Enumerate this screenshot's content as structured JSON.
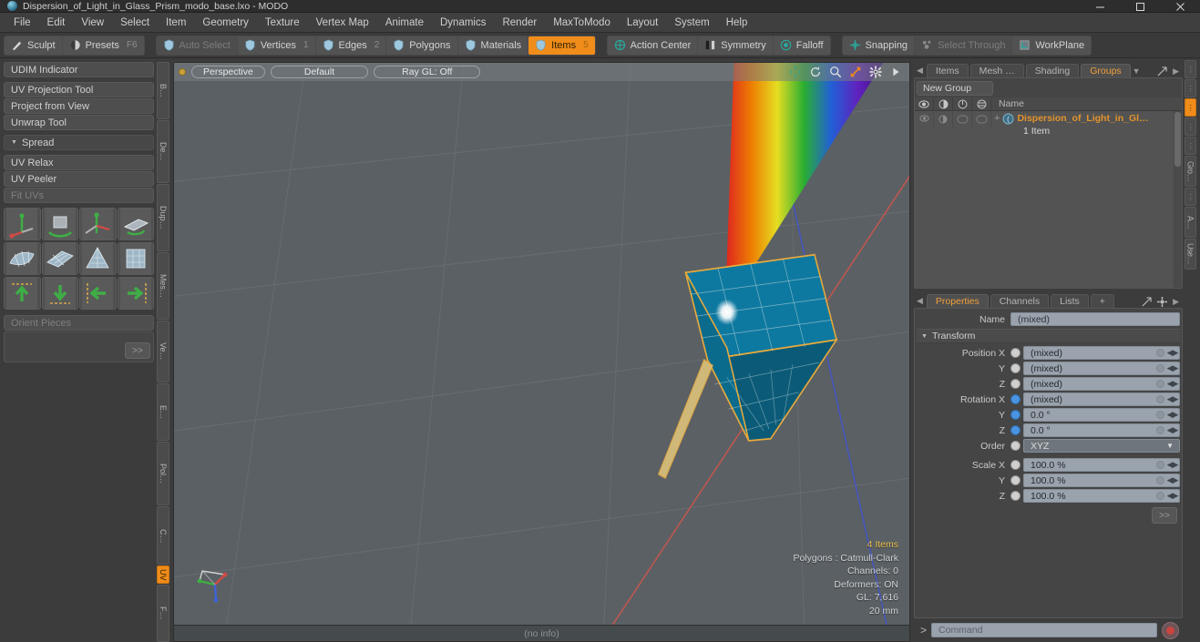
{
  "window": {
    "title": "Dispersion_of_Light_in_Glass_Prism_modo_base.lxo - MODO",
    "app_icon": "modo-sphere-icon",
    "minimize": "–",
    "maximize": "☐",
    "close": "✕"
  },
  "menubar": {
    "items": [
      {
        "label": "File"
      },
      {
        "label": "Edit"
      },
      {
        "label": "View"
      },
      {
        "label": "Select"
      },
      {
        "label": "Item"
      },
      {
        "label": "Geometry"
      },
      {
        "label": "Texture"
      },
      {
        "label": "Vertex Map"
      },
      {
        "label": "Animate"
      },
      {
        "label": "Dynamics"
      },
      {
        "label": "Render"
      },
      {
        "label": "MaxToModo"
      },
      {
        "label": "Layout"
      },
      {
        "label": "System"
      },
      {
        "label": "Help"
      }
    ]
  },
  "toolbar": {
    "group1": [
      {
        "label": "Sculpt",
        "icon": "brush-icon",
        "state": "normal",
        "num": ""
      },
      {
        "label": "Presets",
        "icon": "sphere-icon",
        "state": "normal",
        "num": "F6"
      }
    ],
    "group2": [
      {
        "label": "Auto Select",
        "icon": "shield-icon",
        "state": "dim",
        "num": ""
      },
      {
        "label": "Vertices",
        "icon": "shield-icon",
        "state": "normal",
        "num": "1"
      },
      {
        "label": "Edges",
        "icon": "shield-icon",
        "state": "normal",
        "num": "2"
      },
      {
        "label": "Polygons",
        "icon": "shield-icon",
        "state": "normal",
        "num": ""
      },
      {
        "label": "Materials",
        "icon": "shield-icon",
        "state": "normal",
        "num": ""
      },
      {
        "label": "Items",
        "icon": "shield-icon",
        "state": "active",
        "num": "5"
      }
    ],
    "group3": [
      {
        "label": "Action Center",
        "icon": "target-icon",
        "state": "normal",
        "num": ""
      },
      {
        "label": "Symmetry",
        "icon": "mirror-icon",
        "state": "normal",
        "num": ""
      },
      {
        "label": "Falloff",
        "icon": "falloff-icon",
        "state": "normal",
        "num": ""
      }
    ],
    "group4": [
      {
        "label": "Snapping",
        "icon": "snap-crosshair-icon",
        "state": "normal",
        "num": ""
      },
      {
        "label": "Select Through",
        "icon": "select-through-icon",
        "state": "dim",
        "num": ""
      },
      {
        "label": "WorkPlane",
        "icon": "workplane-icon",
        "state": "normal",
        "num": ""
      }
    ]
  },
  "left_panel": {
    "rows_top": [
      {
        "label": "UDIM Indicator",
        "style": "normal"
      }
    ],
    "rows_mid": [
      {
        "label": "UV Projection Tool",
        "style": "normal"
      },
      {
        "label": "Project from View",
        "style": "normal"
      },
      {
        "label": "Unwrap Tool",
        "style": "normal"
      }
    ],
    "section": {
      "label": "Spread",
      "caret": "▼"
    },
    "rows_bottom": [
      {
        "label": "UV Relax",
        "style": "normal"
      },
      {
        "label": "UV Peeler",
        "style": "normal"
      },
      {
        "label": "Fit UVs",
        "style": "dim"
      }
    ],
    "icon_banks": [
      [
        "uv-projection-gizmo-icon",
        "uv-rotate-cube-icon",
        "uv-move-axis-icon",
        "uv-peel-box-icon"
      ],
      [
        "uv-sphere-mesh-icon",
        "uv-plane-grid-icon",
        "uv-cone-grid-icon",
        "uv-box-grid-icon"
      ],
      [
        "uv-move-up-icon",
        "uv-move-down-icon",
        "uv-move-left-icon",
        "uv-move-right-icon"
      ]
    ],
    "orient_label": "Orient Pieces",
    "more_button": ">>",
    "vtabs": [
      {
        "label": "B…",
        "active": false
      },
      {
        "label": "De…",
        "active": false
      },
      {
        "label": "Dup…",
        "active": false
      },
      {
        "label": "Mes…",
        "active": false
      },
      {
        "label": "Ve…",
        "active": false
      },
      {
        "label": "E…",
        "active": false
      },
      {
        "label": "Pol…",
        "active": false
      },
      {
        "label": "C…",
        "active": false
      },
      {
        "label": "UV",
        "active": true
      },
      {
        "label": "F…",
        "active": false
      }
    ]
  },
  "viewport": {
    "pills": [
      {
        "label": "Perspective"
      },
      {
        "label": "Default"
      },
      {
        "label": "Ray GL: Off"
      }
    ],
    "nav_icons": [
      {
        "name": "pan-icon"
      },
      {
        "name": "rotate-icon"
      },
      {
        "name": "zoom-magnifier-icon"
      },
      {
        "name": "fit-view-icon"
      },
      {
        "name": "gear-icon"
      },
      {
        "name": "play-arrow-icon"
      }
    ],
    "stats": [
      {
        "text": "4 Items",
        "highlight": true
      },
      {
        "text": "Polygons : Catmull-Clark",
        "highlight": false
      },
      {
        "text": "Channels: 0",
        "highlight": false
      },
      {
        "text": "Deformers: ON",
        "highlight": false
      },
      {
        "text": "GL: 7,616",
        "highlight": false
      },
      {
        "text": "20 mm",
        "highlight": false
      }
    ],
    "gizmo_axes": [
      {
        "name": "x-axis",
        "color": "#d04a46"
      },
      {
        "name": "y-axis",
        "color": "#3e62d8"
      },
      {
        "name": "z-axis",
        "color": "#3fae45"
      }
    ],
    "status": "(no info)",
    "scene_colors": {
      "background": "#5b6064",
      "mesh_fill": "#0d7fa8",
      "selection_wire": "#e7a93c",
      "x_axis_line": "#c4564f",
      "y_axis_line": "#4455c4"
    }
  },
  "right_panel": {
    "top_tabs": [
      {
        "label": "Items",
        "active": false
      },
      {
        "label": "Mesh …",
        "active": false
      },
      {
        "label": "Shading",
        "active": false
      },
      {
        "label": "Groups",
        "active": true
      }
    ],
    "top_tab_tools": [
      "chevron-down-icon",
      "expand-icon",
      "right-arrow-icon"
    ],
    "new_group_label": "New Group",
    "tree_columns": [
      {
        "name": "visibility-eye-icon"
      },
      {
        "name": "render-shading-icon"
      },
      {
        "name": "lock-icon"
      },
      {
        "name": "wireframe-icon"
      }
    ],
    "tree_name_header": "Name",
    "tree_rows": [
      {
        "name": "Dispersion_of_Light_in_Gl…",
        "sub": "1 Item",
        "icon": "group-icon",
        "expander": "+"
      }
    ],
    "prop_tabs": [
      {
        "label": "Properties",
        "active": true
      },
      {
        "label": "Channels",
        "active": false
      },
      {
        "label": "Lists",
        "active": false
      },
      {
        "label": "+",
        "active": false
      }
    ],
    "prop_tab_tools": [
      "expand-icon",
      "gear-icon",
      "right-arrow-icon"
    ],
    "name_label": "Name",
    "name_value": "(mixed)",
    "transform_section": "Transform",
    "transform_caret": "▼",
    "properties": [
      {
        "label": "Position X",
        "value": "(mixed)",
        "radio": "off"
      },
      {
        "label": "Y",
        "value": "(mixed)",
        "radio": "off"
      },
      {
        "label": "Z",
        "value": "(mixed)",
        "radio": "off"
      },
      {
        "label": "Rotation X",
        "value": "(mixed)",
        "radio": "on"
      },
      {
        "label": "Y",
        "value": "0.0 °",
        "radio": "on"
      },
      {
        "label": "Z",
        "value": "0.0 °",
        "radio": "on"
      }
    ],
    "order": {
      "label": "Order",
      "value": "XYZ",
      "radio": "off",
      "caret": "▼"
    },
    "scale": [
      {
        "label": "Scale X",
        "value": "100.0 %",
        "radio": "off"
      },
      {
        "label": "Y",
        "value": "100.0 %",
        "radio": "off"
      },
      {
        "label": "Z",
        "value": "100.0 %",
        "radio": "off"
      }
    ],
    "more_button": ">>",
    "side_tabs": [
      {
        "label": "⋮",
        "active": false
      },
      {
        "label": "⋮",
        "active": false
      },
      {
        "label": "⋮",
        "active": true
      },
      {
        "label": "⋮",
        "active": false
      },
      {
        "label": "⋮",
        "active": false
      },
      {
        "label": "Gro…",
        "active": false
      },
      {
        "label": "⋮",
        "active": false
      },
      {
        "label": "A…",
        "active": false
      },
      {
        "label": "Use…",
        "active": false
      }
    ]
  },
  "command_bar": {
    "prompt": ">",
    "placeholder": "Command",
    "record_icon": "record-button-icon"
  }
}
